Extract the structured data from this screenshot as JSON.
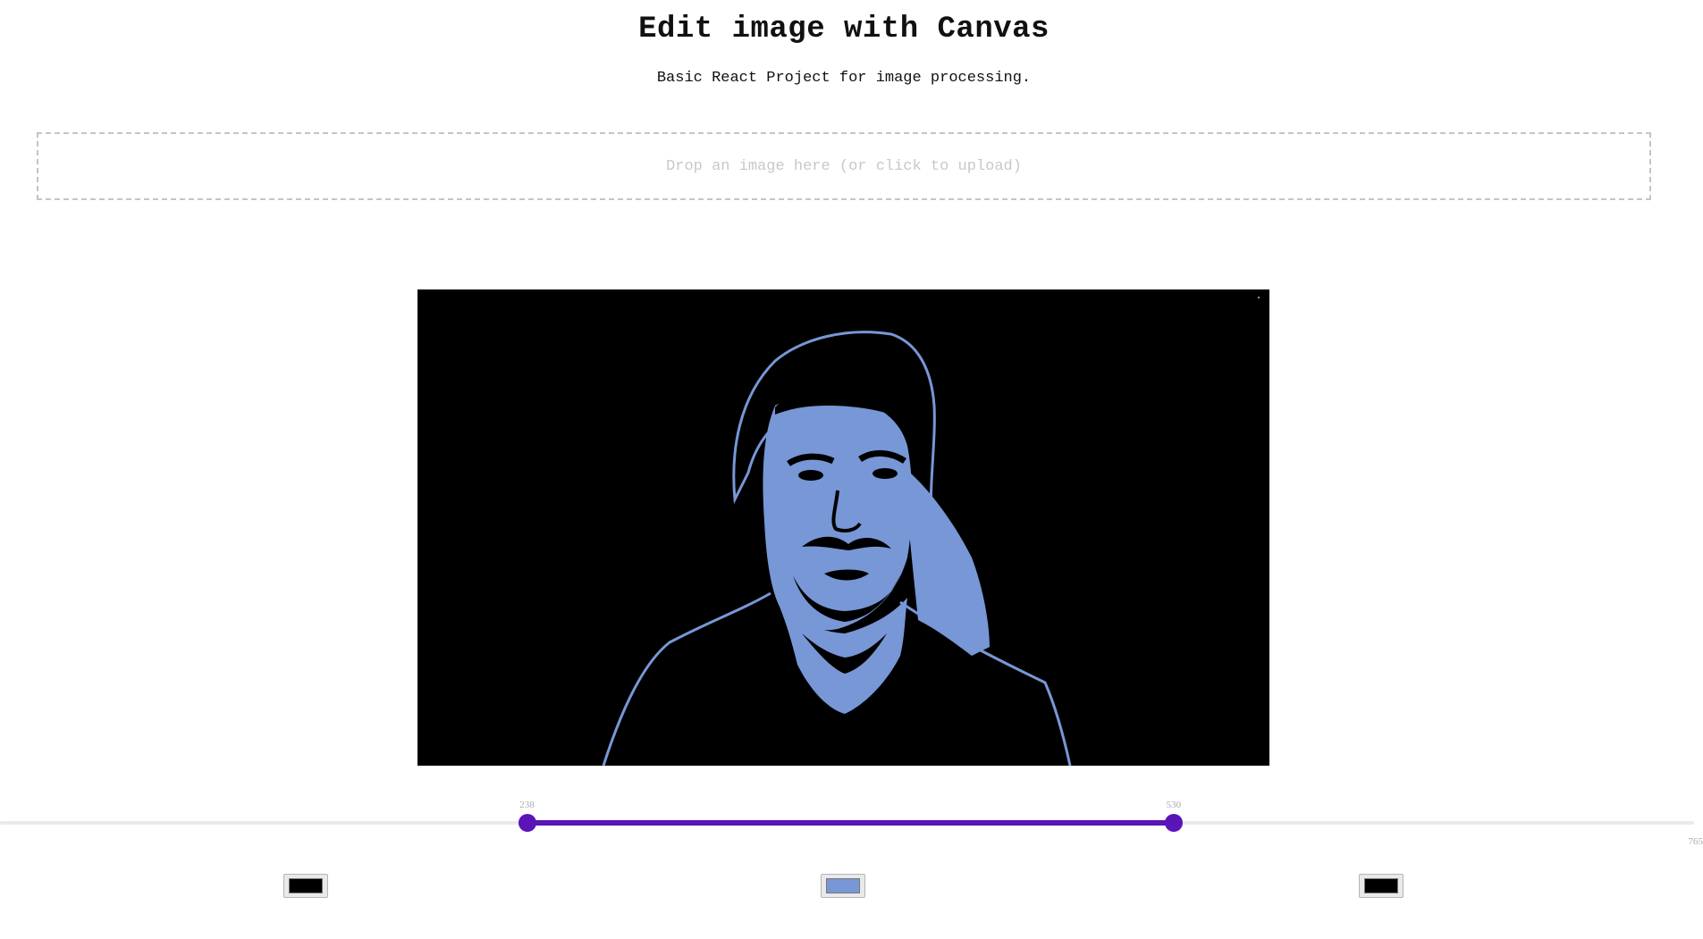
{
  "header": {
    "title": "Edit image with Canvas",
    "subtitle": "Basic React Project for image processing."
  },
  "dropzone": {
    "text": "Drop an image here (or click to upload)"
  },
  "canvas": {
    "image_subject": "portrait-posterized",
    "background_color": "#000000",
    "foreground_color": "#7797d6"
  },
  "slider": {
    "min": 0,
    "max": 765,
    "max_label": "765",
    "low_value": 238,
    "low_label": "238",
    "high_value": 530,
    "high_label": "530",
    "accent_color": "#5a14b8"
  },
  "color_pickers": [
    {
      "name": "color-low",
      "value": "#000000"
    },
    {
      "name": "color-mid",
      "value": "#7797d6"
    },
    {
      "name": "color-high",
      "value": "#000000"
    }
  ]
}
